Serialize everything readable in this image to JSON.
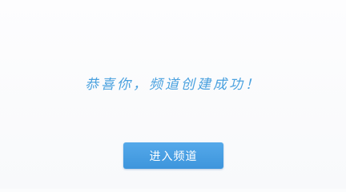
{
  "success": {
    "message": "恭喜你，频道创建成功！"
  },
  "actions": {
    "enter_channel_label": "进入频道"
  },
  "colors": {
    "message_text": "#4aa1df",
    "button_background": "#3d95dc",
    "button_text": "#ffffff",
    "page_background": "#fbfcfd"
  }
}
